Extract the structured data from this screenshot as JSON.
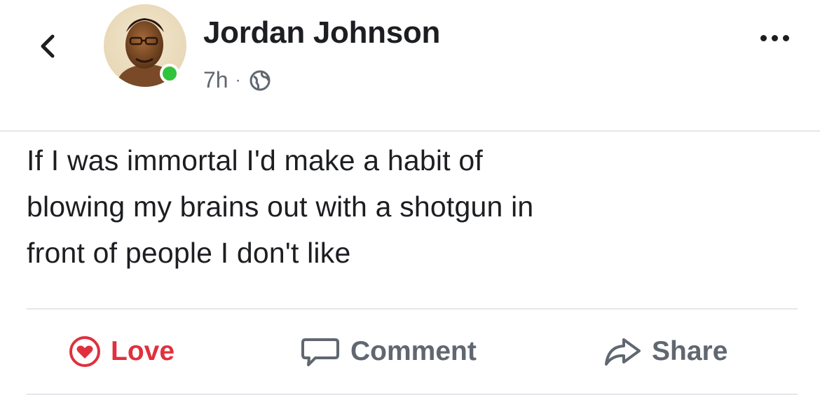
{
  "header": {
    "back_icon": "chevron-left-icon",
    "author_name": "Jordan Johnson",
    "timestamp": "7h",
    "separator": "·",
    "privacy_icon": "globe-icon",
    "more_icon": "more-horizontal-icon",
    "online_status_color": "#2fc43a"
  },
  "post": {
    "text_lines": [
      "If I was immortal I'd make a habit of",
      "blowing my brains out with a shotgun in",
      "front of people I don't like"
    ]
  },
  "actions": {
    "love": {
      "label": "Love",
      "icon": "heart-icon",
      "color": "#e0303e"
    },
    "comment": {
      "label": "Comment",
      "icon": "comment-icon"
    },
    "share": {
      "label": "Share",
      "icon": "share-icon"
    }
  }
}
